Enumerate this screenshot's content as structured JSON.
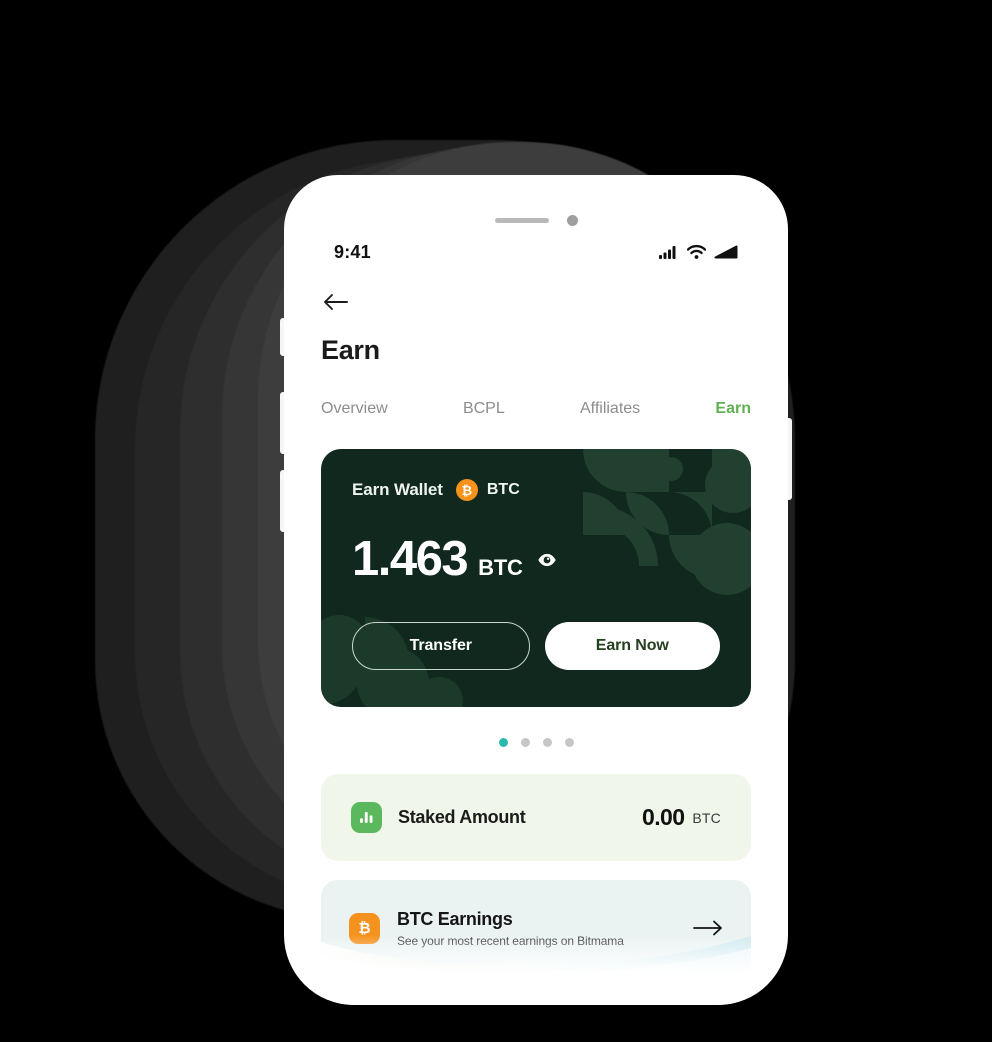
{
  "status_bar": {
    "time": "9:41",
    "icons": [
      "signal-icon",
      "wifi-icon",
      "battery-icon"
    ]
  },
  "header": {
    "back_icon": "arrow-left-icon",
    "title": "Earn"
  },
  "tabs": [
    {
      "label": "Overview",
      "active": false
    },
    {
      "label": "BCPL",
      "active": false
    },
    {
      "label": "Affiliates",
      "active": false
    },
    {
      "label": "Earn",
      "active": true
    }
  ],
  "wallet_card": {
    "label": "Earn Wallet",
    "asset_icon": "bitcoin-icon",
    "asset_symbol": "BTC",
    "balance": "1.463",
    "balance_unit": "BTC",
    "visibility_icon": "eye-icon",
    "transfer_label": "Transfer",
    "earn_now_label": "Earn Now",
    "background_color": "#10281E",
    "pattern_color": "#20402F"
  },
  "carousel": {
    "total": 4,
    "active_index": 0,
    "active_color": "#2CB9AD",
    "inactive_color": "#C6C6C6"
  },
  "staked_card": {
    "icon": "bar-chart-icon",
    "icon_color": "#5CB85C",
    "label": "Staked Amount",
    "amount": "0.00",
    "unit": "BTC",
    "background_color": "#F0F7EA"
  },
  "earnings_card": {
    "icon": "bitcoin-icon",
    "icon_color": "#F5921E",
    "title": "BTC Earnings",
    "subtitle": "See your most recent earnings on Bitmama",
    "arrow_icon": "arrow-right-icon",
    "background_color": "#E9F2F1"
  },
  "theme": {
    "accent_green": "#62B054",
    "dark_green": "#10281E",
    "orange": "#F7931A",
    "teal": "#2CB9AD",
    "page_background": "#000000"
  }
}
